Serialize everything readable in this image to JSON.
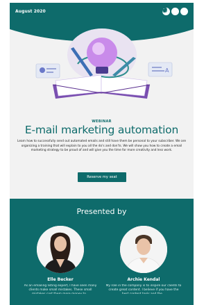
{
  "header": {
    "date": "August 2020",
    "social_icons": [
      "facebook-icon",
      "twitter-icon",
      "instagram-icon"
    ]
  },
  "hero": {
    "eyebrow": "WEBINAR",
    "title": "E-mail marketing automation",
    "description": "Learn how to successfully send out automated emails and still have them be personal to your subscriber. We are organizing a training that will explain to you all the do's and don'ts. We will show you how to create a email marketing strategy to be proud of and will give you the time for more creativity and less work.",
    "cta_label": "Reserve my seat"
  },
  "presenters": {
    "title": "Presented by",
    "speakers": [
      {
        "name": "Elle Becker",
        "bio": "As an emailing listing expert, I have seen many clients make small mistakes. These small mistakes cost them more money to..."
      },
      {
        "name": "Archie Kendal",
        "bio": "My role in the company is to inspire our clients to create great content. I believe if you have the best content tools and the..."
      }
    ]
  },
  "colors": {
    "primary": "#0e6b6b",
    "background": "#f2f2f2",
    "accent_purple": "#b56ee0"
  }
}
